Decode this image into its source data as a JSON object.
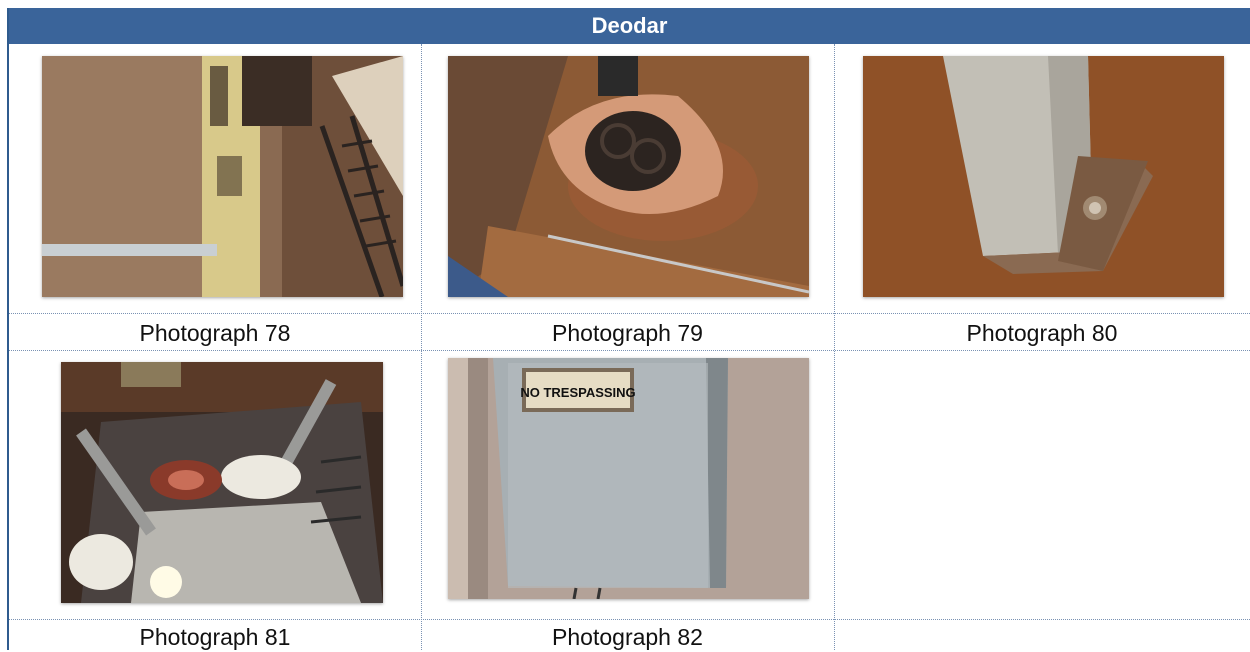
{
  "header": {
    "title": "Deodar"
  },
  "photos": [
    {
      "caption": "Photograph 78",
      "subject": "rusted vertical pipe and ladder inside tank"
    },
    {
      "caption": "Photograph 79",
      "subject": "corroded valve fitting on tank floor"
    },
    {
      "caption": "Photograph 80",
      "subject": "steel post base bolted to rusted floor"
    },
    {
      "caption": "Photograph 81",
      "subject": "valve and pipes in vault viewed from above"
    },
    {
      "caption": "Photograph 82",
      "subject": "galvanized metal box on stucco wall",
      "sign_text": "NO TRESPASSING"
    }
  ],
  "colors": {
    "header_bg": "#3a649a",
    "header_text": "#ffffff",
    "grid": "#7a92b3"
  }
}
